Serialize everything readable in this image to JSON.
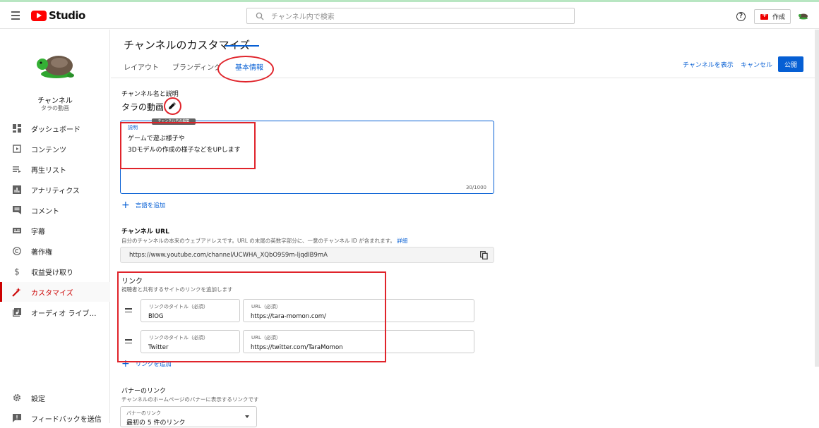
{
  "header": {
    "logo_text": "Studio",
    "search_placeholder": "チャンネル内で検索",
    "help_glyph": "?",
    "create_label": "作成"
  },
  "sidebar": {
    "channel_label": "チャンネル",
    "channel_name": "タラの動画",
    "items": [
      {
        "label": "ダッシュボード",
        "icon": "dashboard-icon"
      },
      {
        "label": "コンテンツ",
        "icon": "content-icon"
      },
      {
        "label": "再生リスト",
        "icon": "playlist-icon"
      },
      {
        "label": "アナリティクス",
        "icon": "analytics-icon"
      },
      {
        "label": "コメント",
        "icon": "comment-icon"
      },
      {
        "label": "字幕",
        "icon": "subtitles-icon"
      },
      {
        "label": "著作権",
        "icon": "copyright-icon"
      },
      {
        "label": "収益受け取り",
        "icon": "dollar-icon"
      },
      {
        "label": "カスタマイズ",
        "icon": "magic-wand-icon",
        "active": true
      },
      {
        "label": "オーディオ ライブ…",
        "icon": "audio-library-icon"
      }
    ],
    "bottom_items": [
      {
        "label": "設定",
        "icon": "gear-icon"
      },
      {
        "label": "フィードバックを送信",
        "icon": "feedback-icon"
      }
    ]
  },
  "main": {
    "page_title": "チャンネルのカスタマイズ",
    "tabs": [
      {
        "label": "レイアウト"
      },
      {
        "label": "ブランディング"
      },
      {
        "label": "基本情報",
        "active": true
      }
    ],
    "actions": {
      "view_channel": "チャンネルを表示",
      "cancel": "キャンセル",
      "publish": "公開"
    },
    "name_section": {
      "label": "チャンネル名と説明",
      "name": "タラの動画",
      "tooltip": "チャンネル名の編集"
    },
    "description": {
      "label": "説明",
      "line1": "ゲームで遊ぶ様子や",
      "line2": "3Dモデルの作成の様子などをUPします",
      "counter": "30/1000"
    },
    "add_language": "言語を追加",
    "url_section": {
      "label": "チャンネル URL",
      "description": "自分のチャンネルの本来のウェブアドレスです。URL の末尾の英数字部分に、一意のチャンネル ID が含まれます。",
      "details_link": "詳細",
      "url": "https://www.youtube.com/channel/UCWHA_XQbO9S9m-ljqdIB9mA"
    },
    "links_section": {
      "label": "リンク",
      "description": "視聴者と共有するサイトのリンクを追加します",
      "links": [
        {
          "title_label": "リンクのタイトル（必須）",
          "title": "BlOG",
          "url_label": "URL（必須）",
          "url": "https://tara-momon.com/"
        },
        {
          "title_label": "リンクのタイトル（必須）",
          "title": "Twitter",
          "url_label": "URL（必須）",
          "url": "https://twitter.com/TaraMomon"
        }
      ],
      "add_link": "リンクを追加"
    },
    "banner_section": {
      "label": "バナーのリンク",
      "description": "チャンネルのホームページのバナーに表示するリンクです",
      "select_label": "バナーのリンク",
      "select_value": "最初の 5 件のリンク"
    }
  },
  "colors": {
    "accent": "#065fd4",
    "brand": "#ff0000",
    "annotation": "#e0242b",
    "active_nav": "#cc0000"
  }
}
